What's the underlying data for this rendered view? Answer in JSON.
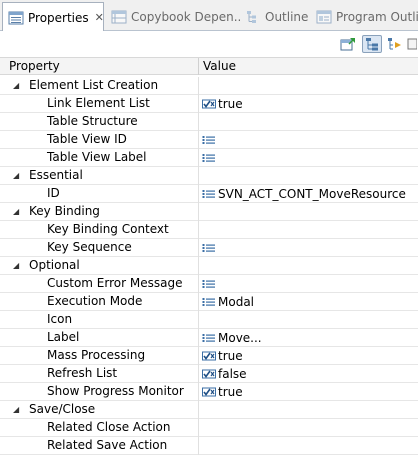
{
  "tabs": [
    {
      "label": "Properties",
      "active": true,
      "icon": "properties-icon",
      "closable": true
    },
    {
      "label": "Copybook Depen...",
      "active": false,
      "icon": "copybook-icon"
    },
    {
      "label": "Outline",
      "active": false,
      "icon": "outline-icon"
    },
    {
      "label": "Program Outline",
      "active": false,
      "icon": "program-outline-icon"
    }
  ],
  "toolbar": {
    "buttons": [
      {
        "icon": "pin-editor-icon",
        "pressed": false
      },
      {
        "icon": "show-categories-icon",
        "pressed": true
      },
      {
        "icon": "show-advanced-icon",
        "pressed": false
      }
    ]
  },
  "table": {
    "columns": [
      "Property",
      "Value"
    ],
    "rows": [
      {
        "type": "category",
        "label": "Element List Creation"
      },
      {
        "type": "property",
        "label": "Link Element List",
        "value": "true",
        "value_icon": "boolean-icon"
      },
      {
        "type": "property",
        "label": "Table Structure",
        "value": "",
        "value_icon": ""
      },
      {
        "type": "property",
        "label": "Table View ID",
        "value": "",
        "value_icon": "list-icon"
      },
      {
        "type": "property",
        "label": "Table View Label",
        "value": "",
        "value_icon": "list-icon"
      },
      {
        "type": "category",
        "label": "Essential"
      },
      {
        "type": "property",
        "label": "ID",
        "value": "SVN_ACT_CONT_MoveResource",
        "value_icon": "list-icon"
      },
      {
        "type": "category",
        "label": "Key Binding"
      },
      {
        "type": "property",
        "label": "Key Binding Context",
        "value": "",
        "value_icon": ""
      },
      {
        "type": "property",
        "label": "Key Sequence",
        "value": "",
        "value_icon": "list-icon"
      },
      {
        "type": "category",
        "label": "Optional"
      },
      {
        "type": "property",
        "label": "Custom Error Message",
        "value": "",
        "value_icon": "list-icon"
      },
      {
        "type": "property",
        "label": "Execution Mode",
        "value": "Modal",
        "value_icon": "list-icon"
      },
      {
        "type": "property",
        "label": "Icon",
        "value": "",
        "value_icon": ""
      },
      {
        "type": "property",
        "label": "Label",
        "value": "Move...",
        "value_icon": "list-icon"
      },
      {
        "type": "property",
        "label": "Mass Processing",
        "value": "true",
        "value_icon": "boolean-icon"
      },
      {
        "type": "property",
        "label": "Refresh List",
        "value": "false",
        "value_icon": "boolean-icon"
      },
      {
        "type": "property",
        "label": "Show Progress Monitor",
        "value": "true",
        "value_icon": "boolean-icon"
      },
      {
        "type": "category",
        "label": "Save/Close"
      },
      {
        "type": "property",
        "label": "Related Close Action",
        "value": "",
        "value_icon": ""
      },
      {
        "type": "property",
        "label": "Related Save Action",
        "value": "",
        "value_icon": ""
      }
    ]
  },
  "colors": {
    "tab_border": "#a7b1be",
    "header_bg": "#f4f4f4",
    "row_line": "#e6e6e6",
    "icon_blue": "#3a6ea5"
  }
}
